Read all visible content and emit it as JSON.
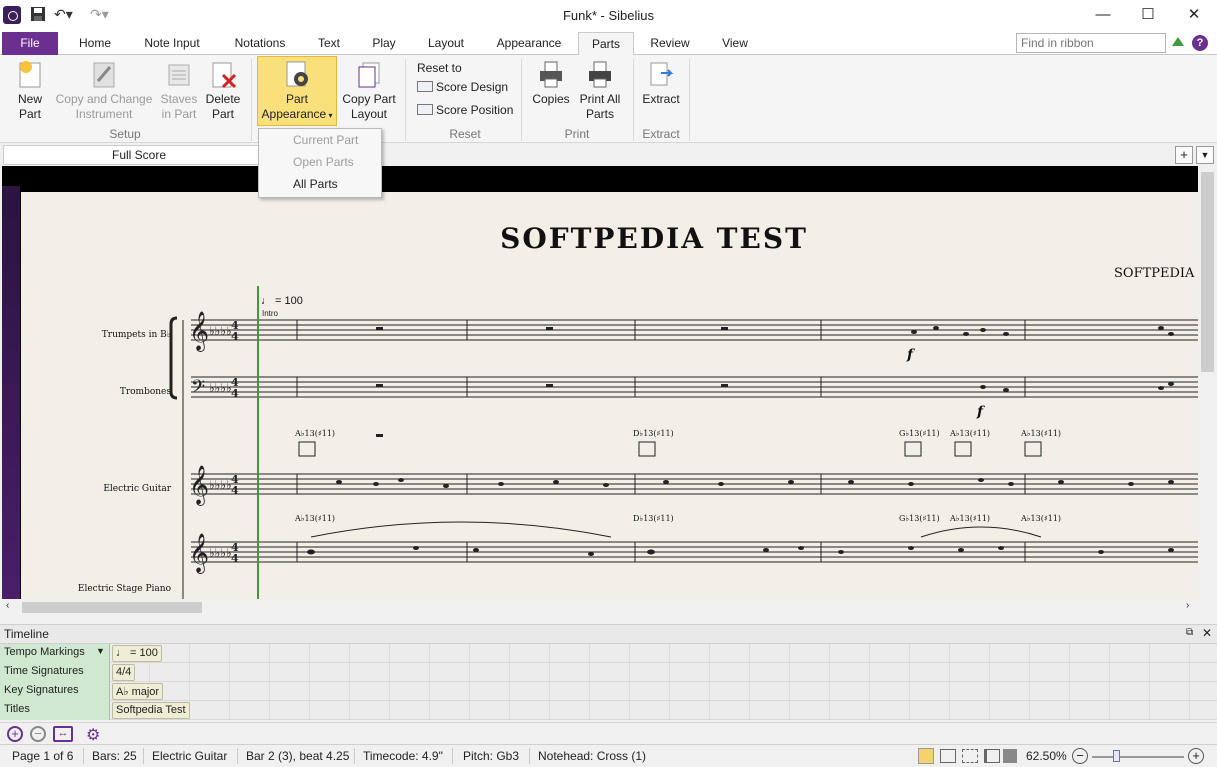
{
  "window": {
    "title": "Funk* - Sibelius"
  },
  "tabs": [
    "File",
    "Home",
    "Note Input",
    "Notations",
    "Text",
    "Play",
    "Layout",
    "Appearance",
    "Parts",
    "Review",
    "View"
  ],
  "ribbon_search_placeholder": "Find in ribbon",
  "ribbon": {
    "new_part": "New\nPart",
    "copy_change": "Copy and Change\nInstrument",
    "staves_in_part": "Staves\nin Part",
    "delete_part": "Delete\nPart",
    "part_appearance": "Part\nAppearance",
    "copy_part_layout": "Copy Part\nLayout",
    "reset_to": "Reset to",
    "score_design": "Score Design",
    "score_position": "Score Position",
    "copies": "Copies",
    "print_all_parts": "Print All\nParts",
    "extract": "Extract",
    "groups": {
      "setup": "Setup",
      "reset": "Reset",
      "print": "Print",
      "extract": "Extract"
    }
  },
  "doc_tab": "Full Score",
  "dropdown": {
    "current_part": "Current Part",
    "open_parts": "Open Parts",
    "all_parts": "All Parts"
  },
  "score": {
    "title": "SOFTPEDIA TEST",
    "composer": "SOFTPEDIA EDI",
    "tempo": "♩ = 100",
    "rehearsal": "Intro",
    "instruments": [
      "Trumpets in B♭",
      "Trombones",
      "Electric Guitar",
      "Electric Stage Piano"
    ],
    "chords": [
      "A♭13(♯11)",
      "D♭13(♯11)",
      "G♭13(♯11)",
      "A♭13(♯11)",
      "A♭13(♯11)"
    ],
    "dynamic": "f"
  },
  "timeline": {
    "title": "Timeline",
    "rows": [
      {
        "label": "Tempo Markings",
        "value": "♩ = 100"
      },
      {
        "label": "Time Signatures",
        "value": "4/4"
      },
      {
        "label": "Key Signatures",
        "value": "A♭ major"
      },
      {
        "label": "Titles",
        "value": "Softpedia Test"
      }
    ]
  },
  "status": {
    "page": "Page 1 of 6",
    "bars": "Bars: 25",
    "instrument": "Electric Guitar",
    "position": "Bar 2 (3), beat 4.25",
    "timecode": "Timecode: 4.9\"",
    "pitch": "Pitch: Gb3",
    "notehead": "Notehead: Cross (1)",
    "zoom": "62.50%"
  }
}
